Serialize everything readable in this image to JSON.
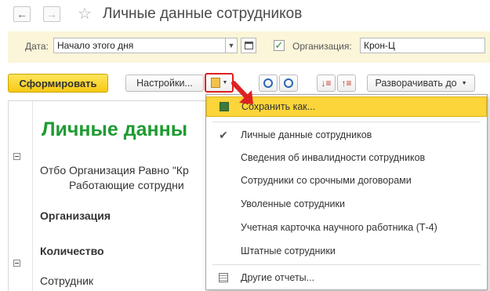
{
  "window": {
    "title": "Личные данные сотрудников"
  },
  "params": {
    "date_label": "Дата:",
    "date_value": "Начало этого дня",
    "org_checkbox_checked": true,
    "org_label": "Организация:",
    "org_value": "Крон-Ц"
  },
  "toolbar": {
    "generate_label": "Сформировать",
    "settings_label": "Настройки...",
    "expand_label": "Разворачивать до"
  },
  "report": {
    "title": "Личные данны",
    "line1_prefix": "Отбо",
    "line1_text": "Организация Равно \"Кр",
    "line2_text": "Работающие сотрудни",
    "org_header": "Организация",
    "count_header": "Количество",
    "employee_header": "Сотрудник"
  },
  "menu": {
    "items": [
      {
        "label": "Сохранить как...",
        "icon": "save-as-icon",
        "highlighted": true
      },
      {
        "label": "Личные данные сотрудников",
        "icon": "checkmark-icon",
        "checked": true
      },
      {
        "label": "Сведения об инвалидности сотрудников"
      },
      {
        "label": "Сотрудники со срочными договорами"
      },
      {
        "label": "Уволенные сотрудники"
      },
      {
        "label": "Учетная карточка научного работника (Т-4)"
      },
      {
        "label": "Штатные сотрудники"
      },
      {
        "label": "Другие отчеты...",
        "icon": "report-list-icon"
      }
    ]
  },
  "colors": {
    "accent_yellow": "#f7c911",
    "highlight": "#fbd53a",
    "report_title_green": "#1f9b32",
    "arrow_red": "#e02020",
    "params_bg": "#fbf5d9"
  }
}
